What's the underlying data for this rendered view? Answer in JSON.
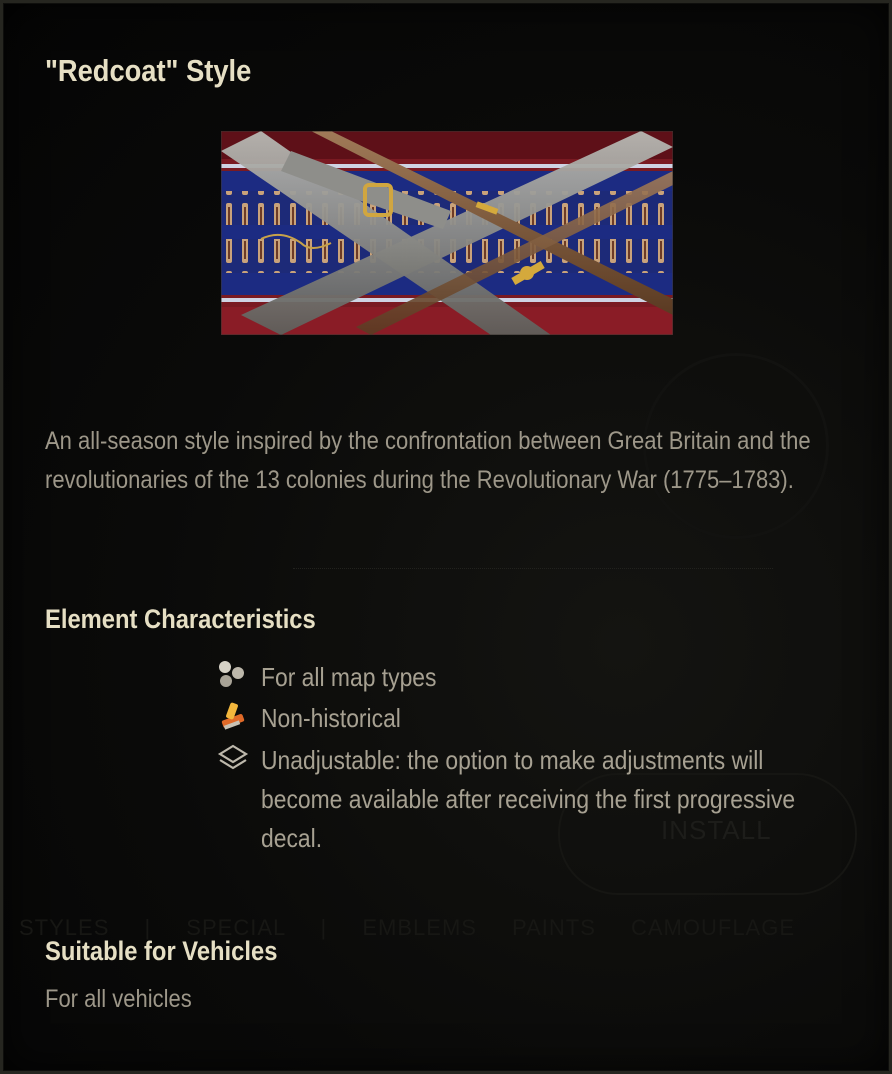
{
  "tooltip": {
    "title": "\"Redcoat\" Style",
    "preview_image": "redcoat-style-preview",
    "description": "An all-season style inspired by the confrontation between Great Britain and the revolutionaries of the 13 colonies during the Revolutionary War (1775–1783).",
    "element_characteristics": {
      "heading": "Element Characteristics",
      "items": [
        {
          "icon": "map-types-icon",
          "text": "For all map types"
        },
        {
          "icon": "non-historical-icon",
          "text": "Non-historical"
        },
        {
          "icon": "layers-icon",
          "text": "Unadjustable: the option to make adjustments will become available after receiving the first progressive decal."
        }
      ]
    },
    "suitable_vehicles": {
      "heading": "Suitable for Vehicles",
      "value": "For all vehicles"
    }
  },
  "background": {
    "install_button": "INSTALL",
    "tabs_text": "STYLES | SPECIAL | EMBLEMS PAINTS CAMOUFLAGE"
  },
  "colors": {
    "heading": "#e6dfc4",
    "body_text": "#9d9789",
    "background": "#050505",
    "border": "#262620"
  }
}
